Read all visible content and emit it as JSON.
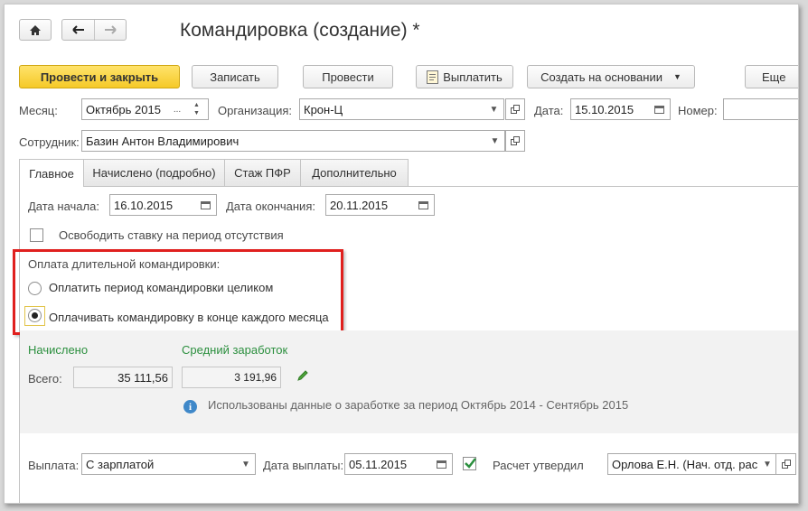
{
  "window": {
    "title": "Командировка (создание) *"
  },
  "toolbar": {
    "post_close": "Провести и закрыть",
    "save": "Записать",
    "post": "Провести",
    "pay": "Выплатить",
    "create_based": "Создать на основании",
    "more": "Еще"
  },
  "header": {
    "month_label": "Месяц:",
    "month_value": "Октябрь 2015",
    "month_ellipsis": "...",
    "org_label": "Организация:",
    "org_value": "Крон-Ц",
    "date_label": "Дата:",
    "date_value": "15.10.2015",
    "number_label": "Номер:",
    "number_value": "",
    "employee_label": "Сотрудник:",
    "employee_value": "Базин Антон Владимирович"
  },
  "tabs": [
    {
      "label": "Главное",
      "active": true
    },
    {
      "label": "Начислено (подробно)",
      "active": false
    },
    {
      "label": "Стаж ПФР",
      "active": false
    },
    {
      "label": "Дополнительно",
      "active": false
    }
  ],
  "main": {
    "start_label": "Дата начала:",
    "start_value": "16.10.2015",
    "end_label": "Дата окончания:",
    "end_value": "20.11.2015",
    "free_rate_label": "Освободить ставку на период отсутствия",
    "free_rate_checked": false,
    "payment_group_label": "Оплата длительной командировки:",
    "option1_label": "Оплатить период командировки целиком",
    "option2_label": "Оплачивать командировку в конце каждого месяца",
    "selected_option": 2
  },
  "summary": {
    "accrued_title": "Начислено",
    "avg_title": "Средний заработок",
    "total_label": "Всего:",
    "total_value": "35 111,56",
    "avg_value": "3 191,96",
    "info_text": "Использованы данные о заработке за период Октябрь 2014 - Сентябрь 2015"
  },
  "footer": {
    "payout_label": "Выплата:",
    "payout_value": "С зарплатой",
    "payout_date_label": "Дата выплаты:",
    "payout_date_value": "05.11.2015",
    "approved_label": "Расчет утвердил",
    "approved_checked": true,
    "approver_value": "Орлова Е.Н. (Нач. отд. рас"
  },
  "colors": {
    "primary_button": "#f5c928",
    "highlight_frame": "#e0201e",
    "section_title": "#2b8f3e",
    "summary_background": "#f2f2f2"
  }
}
